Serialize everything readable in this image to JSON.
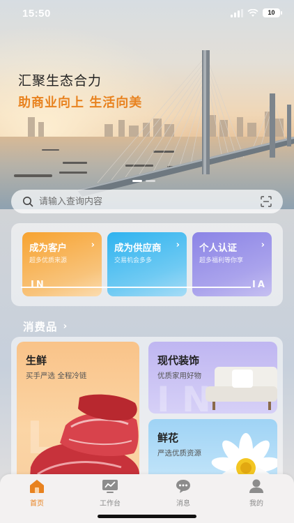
{
  "status_bar": {
    "time": "15:50",
    "battery": "10"
  },
  "hero": {
    "title": "汇聚生态合力",
    "slogan": "助商业向上 生活向美",
    "carousel_pages": 2,
    "carousel_active": 0
  },
  "search": {
    "placeholder": "请输入查询内容"
  },
  "roles": [
    {
      "title": "成为客户",
      "subtitle": "超多优质来源"
    },
    {
      "title": "成为供应商",
      "subtitle": "交易机会多多"
    },
    {
      "title": "个人认证",
      "subtitle": "超多福利等你享"
    }
  ],
  "roles_deco": {
    "left": "IN",
    "right": "IA"
  },
  "consumer_goods": {
    "title": "消费品",
    "items": [
      {
        "title": "生鲜",
        "subtitle": "买手严选 全程冷链"
      },
      {
        "title": "现代装饰",
        "subtitle": "优质家用好物"
      },
      {
        "title": "鲜花",
        "subtitle": "严选优质资源"
      }
    ]
  },
  "tabbar": {
    "items": [
      {
        "label": "首页",
        "icon": "home-icon",
        "active": true
      },
      {
        "label": "工作台",
        "icon": "workbench-icon",
        "active": false
      },
      {
        "label": "消息",
        "icon": "message-icon",
        "active": false
      },
      {
        "label": "我的",
        "icon": "profile-icon",
        "active": false
      }
    ]
  },
  "colors": {
    "accent": "#e8821f",
    "customer": "#f7a331",
    "supplier": "#2fb3ef",
    "personal": "#8b84e6"
  }
}
